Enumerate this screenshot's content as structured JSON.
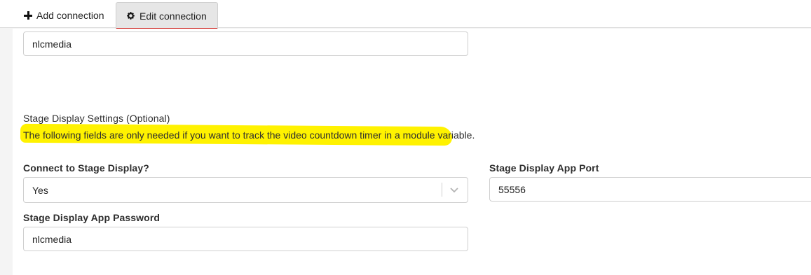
{
  "tabs": {
    "add_label": "Add connection",
    "edit_label": "Edit connection"
  },
  "form": {
    "top_value": "nlcmedia",
    "section_title": "Stage Display Settings (Optional)",
    "section_desc": "The following fields are only needed if you want to track the video countdown timer in a module variable.",
    "connect_label": "Connect to Stage Display?",
    "connect_value": "Yes",
    "port_label": "Stage Display App Port",
    "port_value": "55556",
    "password_label": "Stage Display App Password",
    "password_value": "nlcmedia"
  },
  "colors": {
    "highlight": "#fff200",
    "active_tab_underline": "#d0312d"
  }
}
